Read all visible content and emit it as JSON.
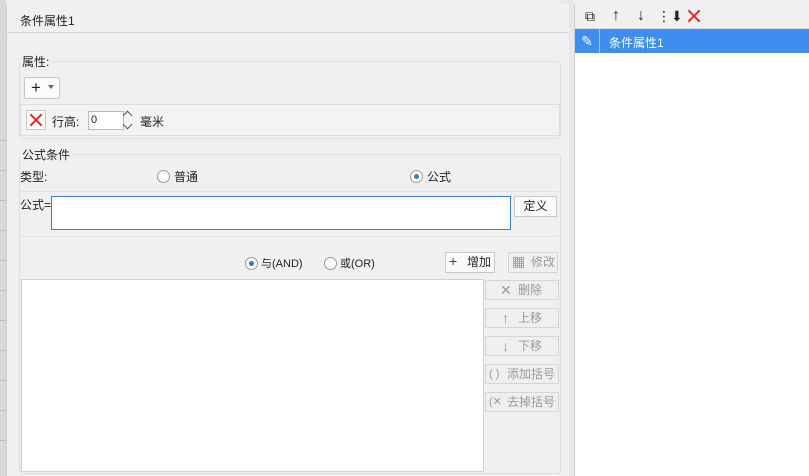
{
  "dialog": {
    "title": "条件属性1",
    "attr_group": {
      "legend": "属性:",
      "add_label": "+",
      "row_height_label": "行高:",
      "row_height_value": "0",
      "unit_label": "毫米"
    },
    "formula_group": {
      "legend": "公式条件",
      "type_label": "类型:",
      "type_options": [
        {
          "label": "普通",
          "selected": false
        },
        {
          "label": "公式",
          "selected": true
        }
      ],
      "formula_label": "公式=",
      "formula_value": "",
      "define_label": "定义",
      "logic_options": [
        {
          "label": "与(AND)",
          "selected": true
        },
        {
          "label": "或(OR)",
          "selected": false
        }
      ],
      "add_label": "增加",
      "modify_label": "修改",
      "actions": {
        "delete": "删除",
        "move_up": "上移",
        "move_down": "下移",
        "add_bracket": "添加括号",
        "remove_bracket": "去掉括号"
      }
    }
  },
  "right_panel": {
    "toolbar": [
      "copy-icon",
      "arrow-up-icon",
      "arrow-down-icon",
      "move-bottom-icon",
      "delete-icon"
    ],
    "items": [
      {
        "label": "条件属性1",
        "selected": true
      }
    ]
  },
  "colors": {
    "accent": "#3e8ef0",
    "delete_red": "#e02828",
    "focus_border": "#3c7fd6"
  }
}
